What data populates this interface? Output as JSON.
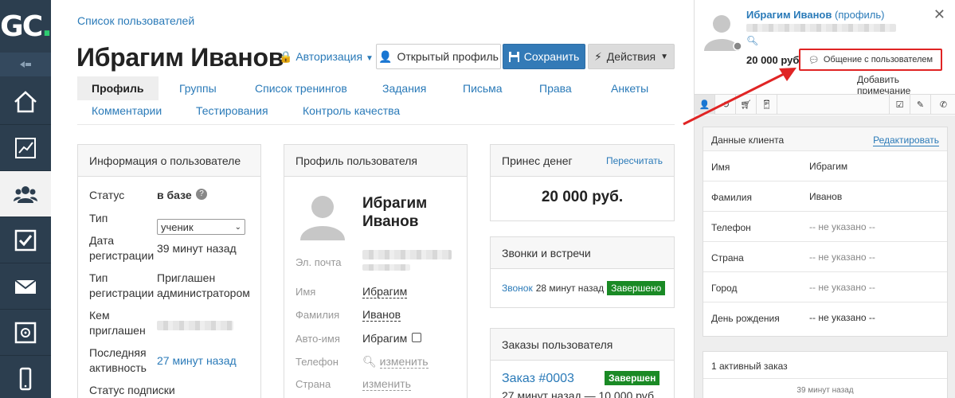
{
  "logo": {
    "text": "GC",
    "dot": "."
  },
  "breadcrumb": "Список пользователей",
  "title": "Ибрагим Иванов",
  "toolbar": {
    "auth_label": "Авторизация",
    "open_profile": "Открытый профиль",
    "save": "Сохранить",
    "actions": "Действия"
  },
  "tabs": [
    "Профиль",
    "Группы",
    "Список тренингов",
    "Задания",
    "Письма",
    "Права",
    "Анкеты",
    "Комментарии",
    "Тестирования",
    "Контроль качества"
  ],
  "user_info": {
    "header": "Информация о пользователе",
    "status_label": "Статус",
    "status_value": "в базе",
    "type_label": "Тип",
    "type_value": "ученик",
    "reg_date_label_1": "Дата",
    "reg_date_label_2": "регистрации",
    "reg_date_value": "39 минут назад",
    "reg_type_label_1": "Тип",
    "reg_type_label_2": "регистрации",
    "reg_type_value_1": "Приглашен",
    "reg_type_value_2": "администратором",
    "invited_label_1": "Кем",
    "invited_label_2": "приглашен",
    "last_active_label_1": "Последняя",
    "last_active_label_2": "активность",
    "last_active_value": "27 минут назад",
    "subscription_label": "Статус подписки"
  },
  "profile": {
    "header": "Профиль пользователя",
    "name_line1": "Ибрагим",
    "name_line2": "Иванов",
    "email_label": "Эл. почта",
    "first_label": "Имя",
    "first_value": "Ибрагим",
    "last_label": "Фамилия",
    "last_value": "Иванов",
    "autoname_label": "Авто-имя",
    "autoname_value": "Ибрагим",
    "phone_label": "Телефон",
    "phone_action": "изменить",
    "country_label": "Страна",
    "country_action": "изменить"
  },
  "money": {
    "header": "Принес денег",
    "recalc": "Пересчитать",
    "amount": "20 000 руб."
  },
  "calls": {
    "header": "Звонки и встречи",
    "call_link": "Звонок",
    "call_time": "28 минут назад",
    "call_status": "Завершено"
  },
  "orders": {
    "header": "Заказы пользователя",
    "order_link": "Заказ #0003",
    "order_status": "Завершен",
    "order_meta": "27 минут назад — 10 000 руб."
  },
  "right_panel": {
    "name": "Ибрагим Иванов",
    "profile_link": "(профиль)",
    "money": "20 000 руб",
    "chat_button": "Общение с пользователем",
    "add_note": "Добавить примечание",
    "client_header": "Данные клиента",
    "edit": "Редактировать",
    "rows": [
      {
        "k": "Имя",
        "v": "Ибрагим"
      },
      {
        "k": "Фамилия",
        "v": "Иванов"
      },
      {
        "k": "Телефон",
        "v": "-- не указано --"
      },
      {
        "k": "Страна",
        "v": "-- не указано --"
      },
      {
        "k": "Город",
        "v": "-- не указано --"
      },
      {
        "k": "День рождения",
        "v": "-- не указано --"
      }
    ],
    "active_orders": "1 активный заказ",
    "order_time": "39 минут назад"
  },
  "colors": {
    "accent": "#2a7ab8",
    "primary_btn": "#337ab7",
    "sidebar": "#2c3e4f",
    "success": "#1a8a25",
    "highlight": "#e02424"
  }
}
